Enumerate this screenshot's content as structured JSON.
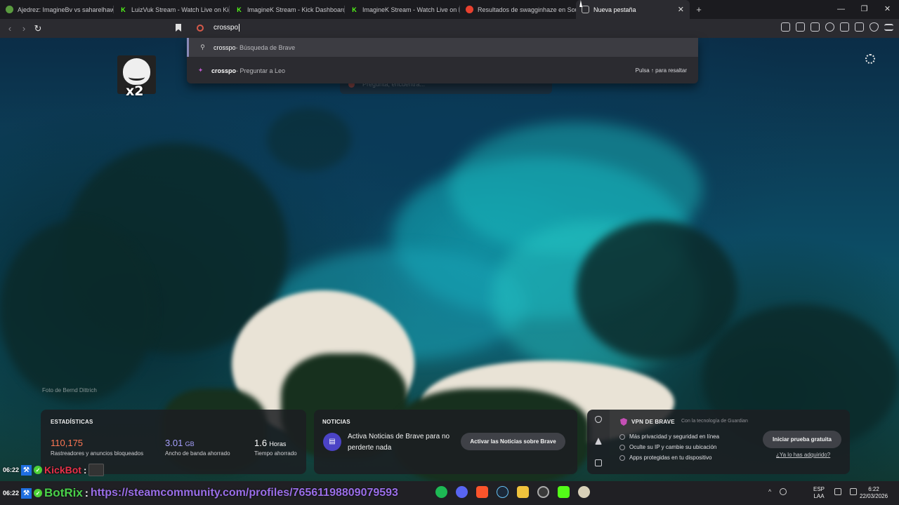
{
  "tabs": [
    {
      "title": "Ajedrez: ImagineBv vs saharelhawary",
      "icon": "chess-icon",
      "color": "#5a9b3f"
    },
    {
      "title": "LuizVuk Stream - Watch Live on Kick",
      "icon": "kick-icon",
      "color": "#53fc18"
    },
    {
      "title": "ImagineK Stream - Kick Dashboard",
      "icon": "kick-icon",
      "color": "#53fc18"
    },
    {
      "title": "ImagineK Stream - Watch Live on Kick",
      "icon": "kick-icon",
      "color": "#53fc18"
    },
    {
      "title": "Resultados de swagginhaze en Sound",
      "icon": "soundcloud-icon",
      "color": "#e8412f"
    },
    {
      "title": "Nueva pestaña",
      "icon": "brave-icon",
      "active": true
    }
  ],
  "omnibox": {
    "value": "crosspo"
  },
  "suggestions": [
    {
      "query": "crosspo",
      "suffix": " - Búsqueda de Brave"
    },
    {
      "query": "crosspo",
      "suffix": " - Preguntar a Leo",
      "hint": "Pulsa ↑ para resaltar"
    }
  ],
  "leo": {
    "placeholder": "Pregunta, encuentra..."
  },
  "meme": {
    "caption": "x2"
  },
  "photo_credit": "Foto de Bernd Dittrich",
  "stats": {
    "title": "ESTADÍSTICAS",
    "blocked": {
      "value": "110,175",
      "label": "Rastreadores y anuncios bloqueados",
      "color": "#ff7754"
    },
    "bandwidth": {
      "value": "3.01",
      "unit": "GB",
      "label": "Ancho de banda ahorrado",
      "color": "#a7a1ff"
    },
    "time": {
      "value": "1.6",
      "unit": "Horas",
      "label": "Tiempo ahorrado"
    }
  },
  "news": {
    "title": "NOTICIAS",
    "text": "Activa Noticias de Brave para no perderte nada",
    "button": "Activar las Noticias sobre Brave"
  },
  "vpn": {
    "title": "VPN DE BRAVE",
    "powered_by": "Con la tecnología de Guardian",
    "features": [
      "Más privacidad y seguridad en línea",
      "Oculte su IP y cambie su ubicación",
      "Apps protegidas en tu dispositivo"
    ],
    "button": "Iniciar prueba gratuita",
    "link": "¿Ya lo has adquirido?"
  },
  "chat": [
    {
      "time": "06:22",
      "user": "KickBot",
      "sep": ":"
    },
    {
      "time": "06:22",
      "user": "BotRix",
      "sep": ":",
      "message": "https://steamcommunity.com/profiles/76561198809079593"
    }
  ],
  "tray": {
    "lang_top": "ESP",
    "lang_bottom": "LAA",
    "time": "6:22",
    "date": "22/03/2026"
  }
}
